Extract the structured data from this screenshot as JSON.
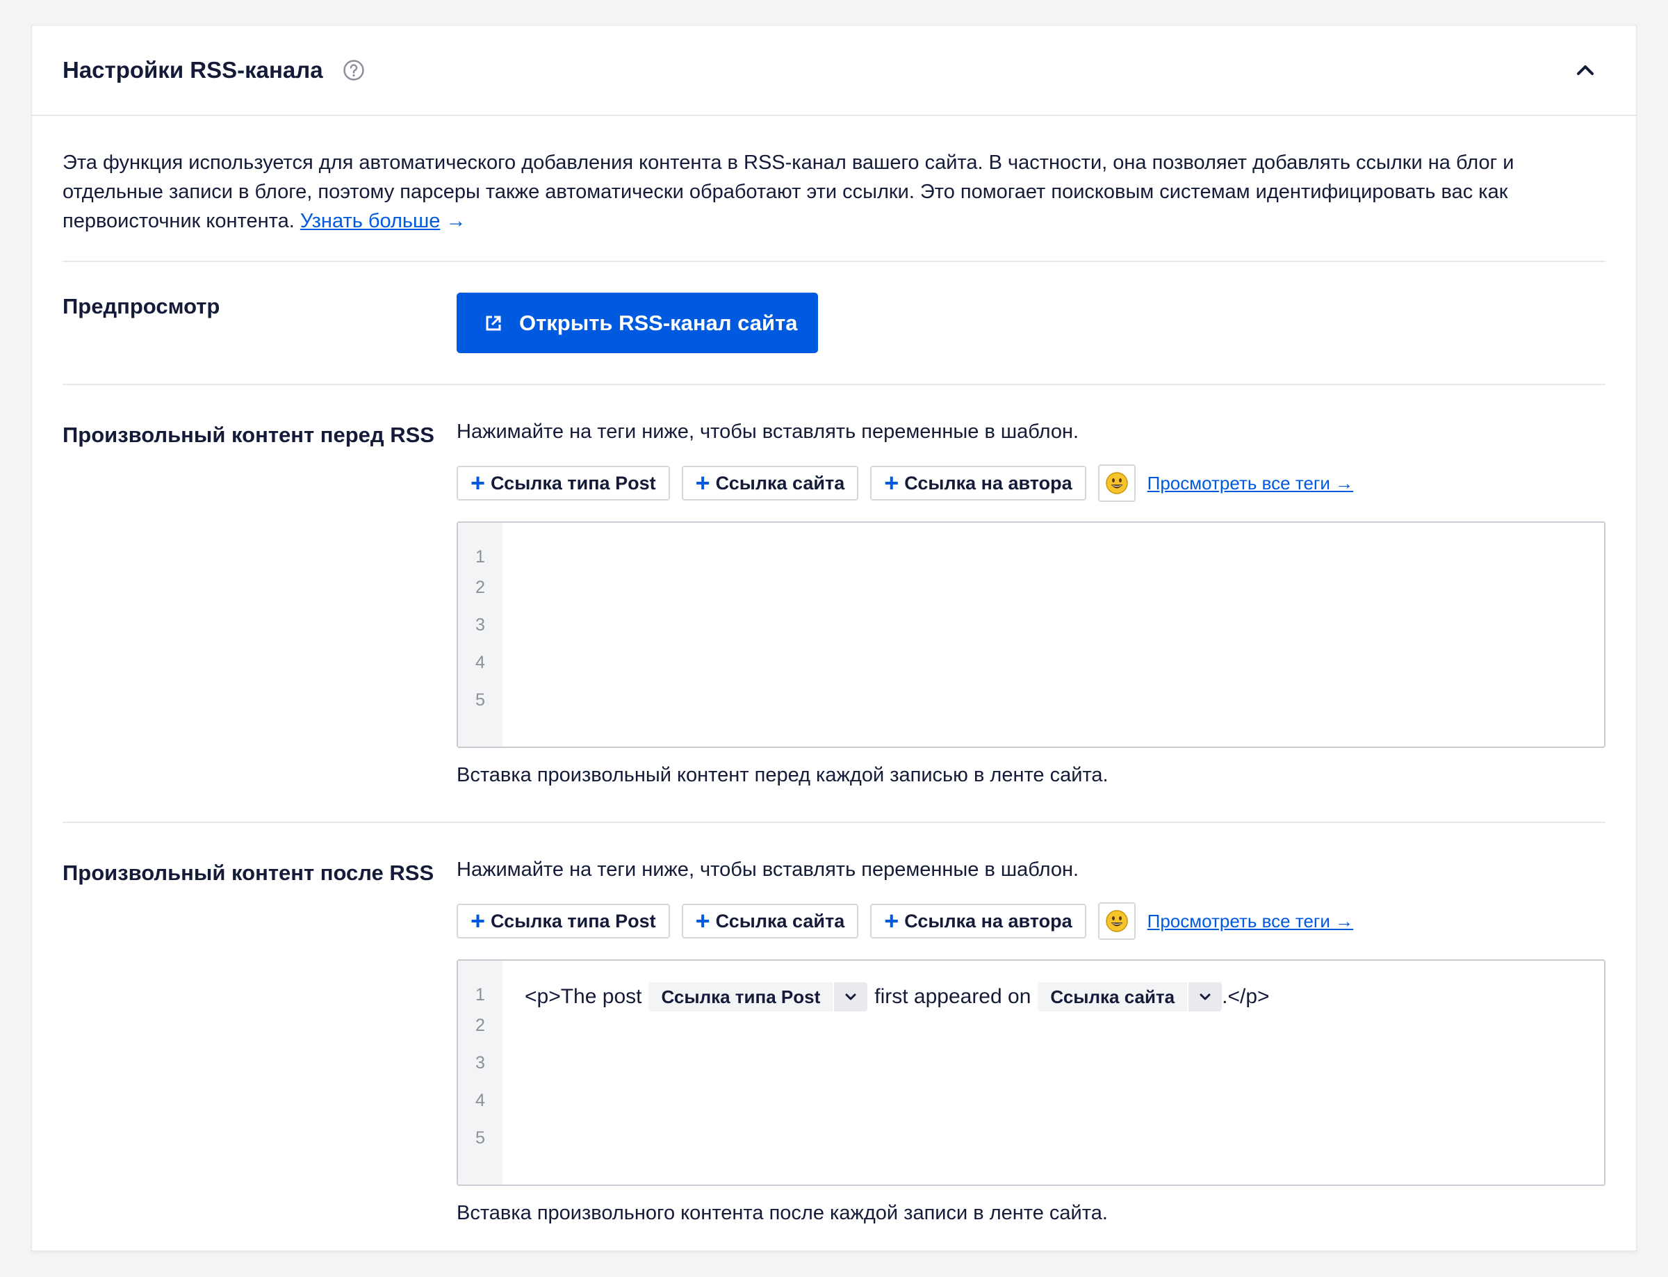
{
  "panel": {
    "title": "Настройки RSS-канала",
    "help_icon": "question-circle-icon",
    "collapse_icon": "chevron-up-icon"
  },
  "intro": {
    "text": "Эта функция используется для автоматического добавления контента в RSS-канал вашего сайта. В частности, она позволяет добавлять ссылки на блог и отдельные записи в блоге, поэтому парсеры также автоматически обработают эти ссылки. Это помогает поисковым системам идентифицировать вас как первоисточник контента. ",
    "link_label": "Узнать больше",
    "link_arrow": "→"
  },
  "preview": {
    "label": "Предпросмотр",
    "button_label": "Открыть RSS-канал сайта",
    "button_icon": "external-link-icon"
  },
  "before": {
    "label": "Произвольный контент перед RSS",
    "hint": "Нажимайте на теги ниже, чтобы вставлять переменные в шаблон.",
    "tags": [
      "Ссылка типа Post",
      "Ссылка сайта",
      "Ссылка на автора"
    ],
    "view_all": "Просмотреть все теги →",
    "lines": [
      "1",
      "2",
      "3",
      "4",
      "5"
    ],
    "description": "Вставка произвольный контент перед каждой записью в ленте сайта."
  },
  "after": {
    "label": "Произвольный контент после RSS",
    "hint": "Нажимайте на теги ниже, чтобы вставлять переменные в шаблон.",
    "tags": [
      "Ссылка типа Post",
      "Ссылка сайта",
      "Ссылка на автора"
    ],
    "view_all": "Просмотреть все теги →",
    "lines": [
      "1",
      "2",
      "3",
      "4",
      "5"
    ],
    "code": {
      "part1": "<p>The post",
      "chip1": "Ссылка типа Post",
      "part2": "first appeared on",
      "chip2": "Ссылка сайта",
      "part3": ".</p>"
    },
    "description": "Вставка произвольного контента после каждой записи в ленте сайта."
  },
  "colors": {
    "accent": "#005ae0",
    "text": "#141b38",
    "background": "#f3f4f5"
  }
}
